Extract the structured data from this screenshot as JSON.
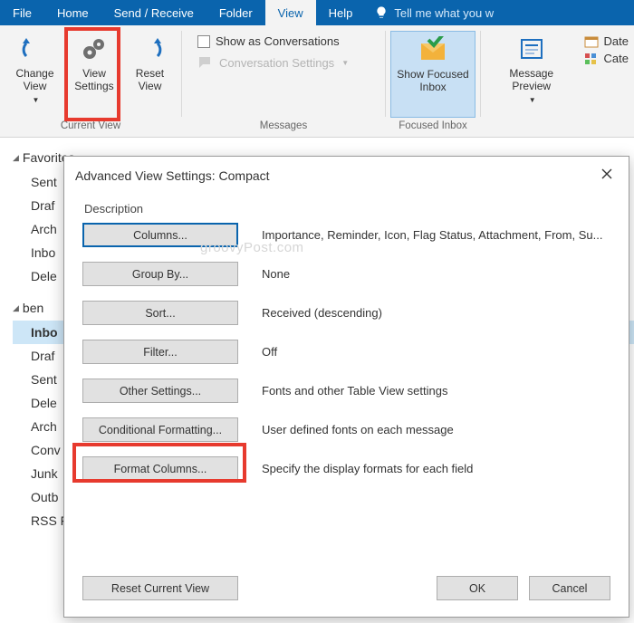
{
  "tabs": {
    "file": "File",
    "home": "Home",
    "send_receive": "Send / Receive",
    "folder": "Folder",
    "view": "View",
    "help": "Help",
    "tell_me": "Tell me what you w"
  },
  "ribbon": {
    "current_view": {
      "label": "Current View",
      "change_view": "Change View",
      "view_settings": "View Settings",
      "reset_view": "Reset View"
    },
    "messages": {
      "label": "Messages",
      "show_conversations": "Show as Conversations",
      "conversation_settings": "Conversation Settings"
    },
    "focused_inbox": {
      "label": "Focused Inbox",
      "button": "Show Focused Inbox"
    },
    "message_preview": "Message Preview",
    "arrangement": {
      "date": "Date",
      "cate": "Cate"
    }
  },
  "nav": {
    "favorites": "Favorites",
    "fav_items": [
      "Sent",
      "Draf",
      "Arch",
      "Inbo",
      "Dele"
    ],
    "account": "ben",
    "account_items": [
      "Inbo",
      "Draf",
      "Sent",
      "Dele",
      "Arch",
      "Conv",
      "Junk",
      "Outb",
      "RSS Feeds"
    ],
    "selected_index": 0
  },
  "dialog": {
    "title": "Advanced View Settings: Compact",
    "watermark": "groovyPost.com",
    "description_label": "Description",
    "rows": [
      {
        "btn": "Columns...",
        "txt": "Importance, Reminder, Icon, Flag Status, Attachment, From, Su...",
        "selected": true
      },
      {
        "btn": "Group By...",
        "txt": "None"
      },
      {
        "btn": "Sort...",
        "txt": "Received (descending)"
      },
      {
        "btn": "Filter...",
        "txt": "Off"
      },
      {
        "btn": "Other Settings...",
        "txt": "Fonts and other Table View settings"
      },
      {
        "btn": "Conditional Formatting...",
        "txt": "User defined fonts on each message",
        "highlight": true
      },
      {
        "btn": "Format Columns...",
        "txt": "Specify the display formats for each field"
      }
    ],
    "reset": "Reset Current View",
    "ok": "OK",
    "cancel": "Cancel"
  }
}
